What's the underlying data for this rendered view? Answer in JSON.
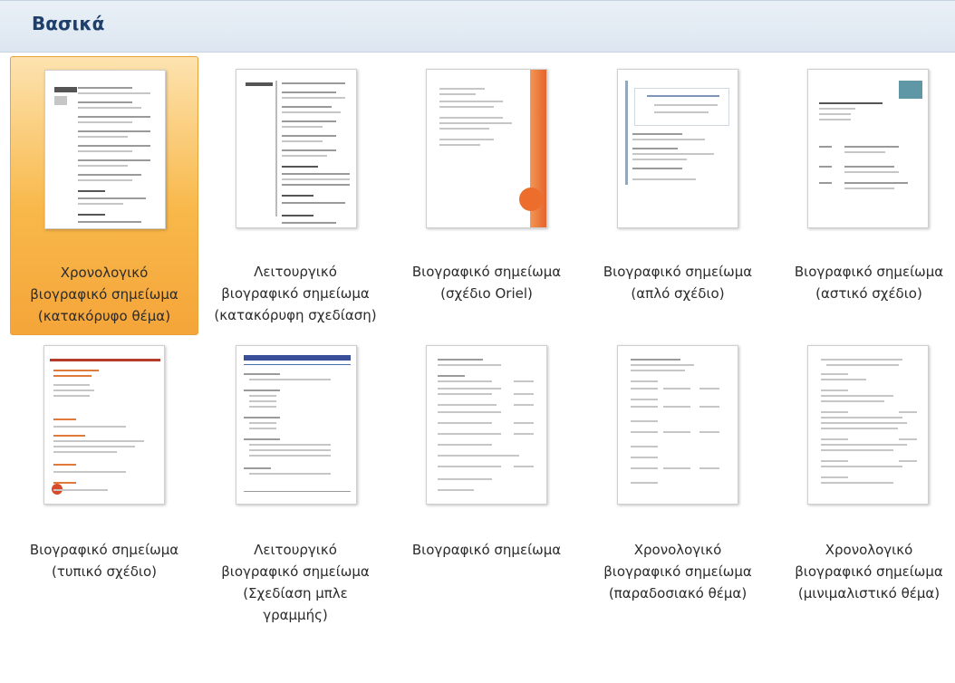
{
  "header": {
    "title": "Βασικά"
  },
  "templates": [
    {
      "lines": [
        "Χρονολογικό",
        "βιογραφικό σημείωμα",
        "(κατακόρυφο θέμα)"
      ],
      "selected": true
    },
    {
      "lines": [
        "Λειτουργικό",
        "βιογραφικό σημείωμα",
        "(κατακόρυφη σχεδίαση)"
      ],
      "selected": false
    },
    {
      "lines": [
        "Βιογραφικό σημείωμα",
        "(σχέδιο Oriel)"
      ],
      "selected": false
    },
    {
      "lines": [
        "Βιογραφικό σημείωμα",
        "(απλό σχέδιο)"
      ],
      "selected": false
    },
    {
      "lines": [
        "Βιογραφικό σημείωμα",
        "(αστικό σχέδιο)"
      ],
      "selected": false
    },
    {
      "lines": [
        "Βιογραφικό σημείωμα",
        "(τυπικό σχέδιο)"
      ],
      "selected": false
    },
    {
      "lines": [
        "Λειτουργικό",
        "βιογραφικό σημείωμα",
        "(Σχεδίαση μπλε",
        "γραμμής)"
      ],
      "selected": false
    },
    {
      "lines": [
        "Βιογραφικό σημείωμα"
      ],
      "selected": false
    },
    {
      "lines": [
        "Χρονολογικό",
        "βιογραφικό σημείωμα",
        "(παραδοσιακό θέμα)"
      ],
      "selected": false
    },
    {
      "lines": [
        "Χρονολογικό",
        "βιογραφικό σημείωμα",
        "(μινιμαλιστικό θέμα)"
      ],
      "selected": false
    }
  ]
}
